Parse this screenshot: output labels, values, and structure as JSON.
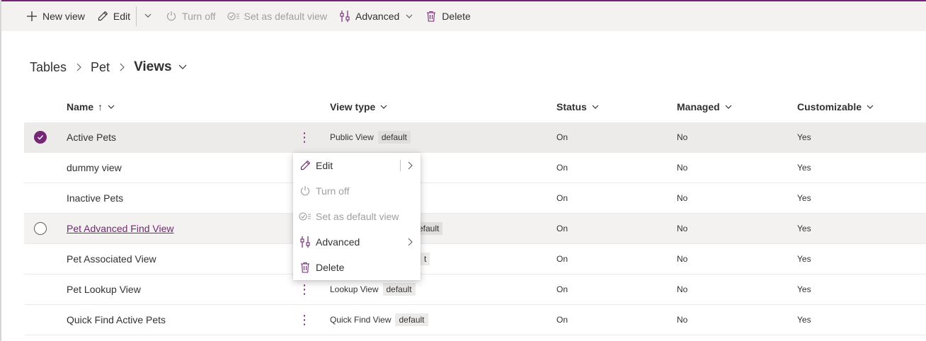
{
  "toolbar": {
    "new_view": "New view",
    "edit": "Edit",
    "turn_off": "Turn off",
    "set_default": "Set as default view",
    "advanced": "Advanced",
    "delete": "Delete"
  },
  "breadcrumb": {
    "items": [
      "Tables",
      "Pet"
    ],
    "current": "Views"
  },
  "table": {
    "columns": {
      "name": "Name",
      "name_sort": "↑",
      "view_type": "View type",
      "status": "Status",
      "managed": "Managed",
      "customizable": "Customizable"
    },
    "rows": [
      {
        "name": "Active Pets",
        "view_type": "Public View",
        "badge": "default",
        "status": "On",
        "managed": "No",
        "customizable": "Yes"
      },
      {
        "name": "dummy view",
        "view_type": "",
        "badge": "",
        "status": "On",
        "managed": "No",
        "customizable": "Yes"
      },
      {
        "name": "Inactive Pets",
        "view_type": "",
        "badge": "",
        "status": "On",
        "managed": "No",
        "customizable": "Yes"
      },
      {
        "name": "Pet Advanced Find View",
        "view_type": "",
        "badge": "efault",
        "status": "On",
        "managed": "No",
        "customizable": "Yes"
      },
      {
        "name": "Pet Associated View",
        "view_type": "",
        "badge": "t",
        "status": "On",
        "managed": "No",
        "customizable": "Yes"
      },
      {
        "name": "Pet Lookup View",
        "view_type": "Lookup View",
        "badge": "default",
        "status": "On",
        "managed": "No",
        "customizable": "Yes"
      },
      {
        "name": "Quick Find Active Pets",
        "view_type": "Quick Find View",
        "badge": "default",
        "status": "On",
        "managed": "No",
        "customizable": "Yes"
      }
    ]
  },
  "context_menu": {
    "edit": "Edit",
    "turn_off": "Turn off",
    "set_default": "Set as default view",
    "advanced": "Advanced",
    "delete": "Delete"
  },
  "colors": {
    "accent": "#742774",
    "toolbar_bg": "#f3f2f1",
    "selected_row": "#edebe9",
    "disabled_text": "#a19f9d"
  }
}
